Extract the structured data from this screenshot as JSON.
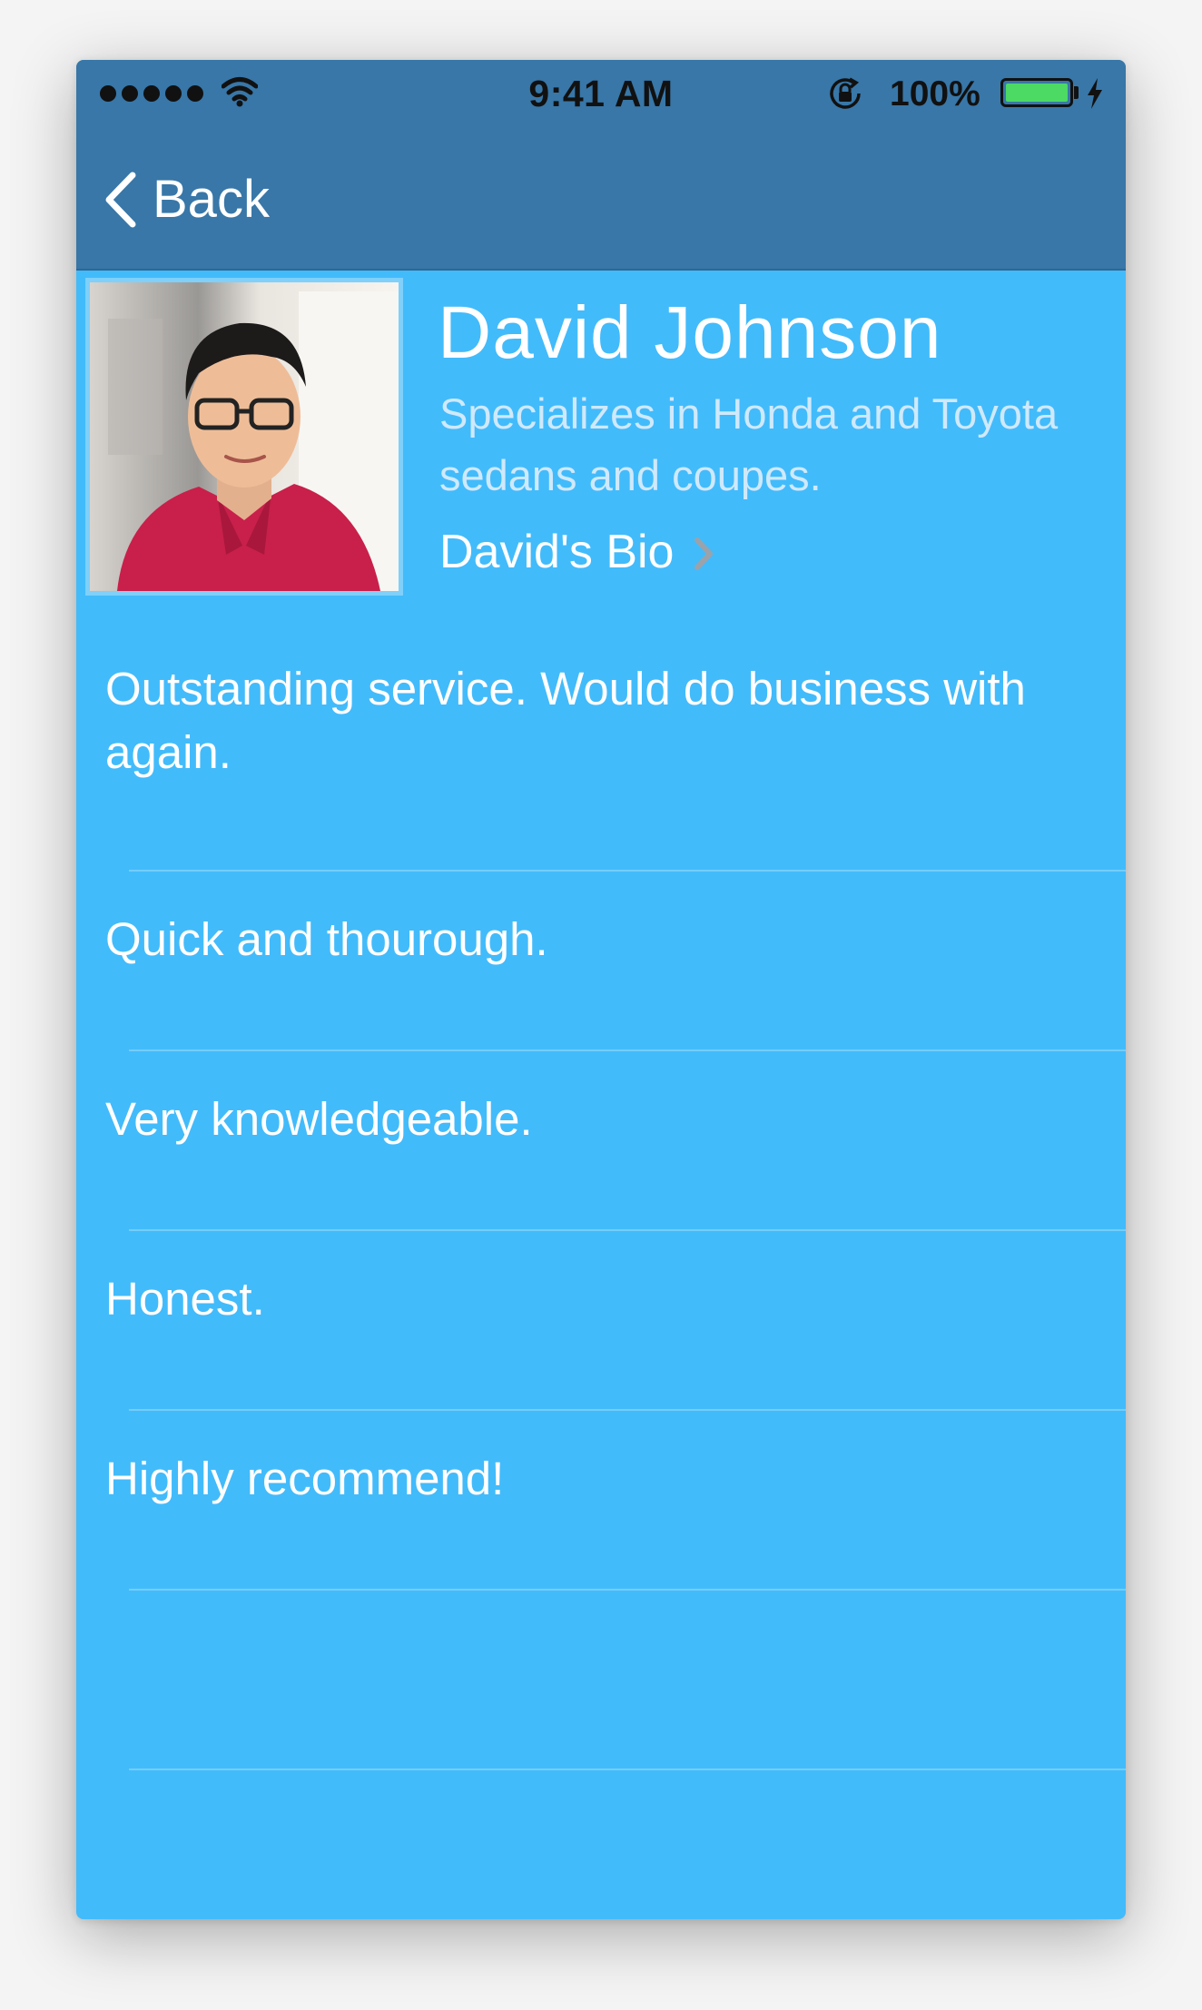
{
  "status_bar": {
    "time": "9:41 AM",
    "battery_percent": "100%",
    "battery_level": 1.0
  },
  "nav": {
    "back_label": "Back"
  },
  "profile": {
    "name": "David Johnson",
    "specialty": "Specializes in Honda and Toyota sedans and coupes.",
    "bio_link_label": "David's Bio"
  },
  "reviews": [
    "Outstanding service. Would do business with again.",
    "Quick and thourough.",
    "Very knowledgeable.",
    "Honest.",
    "Highly recommend!",
    "",
    ""
  ],
  "colors": {
    "nav_background": "#3877a8",
    "content_background": "#42bbfb",
    "battery_green": "#4cd964"
  },
  "icons": {
    "back": "chevron-left-icon",
    "bio": "chevron-right-icon",
    "signal": "signal-dots-icon",
    "wifi": "wifi-icon",
    "orientation_lock": "rotation-lock-icon",
    "battery": "battery-icon",
    "charging": "bolt-icon"
  }
}
